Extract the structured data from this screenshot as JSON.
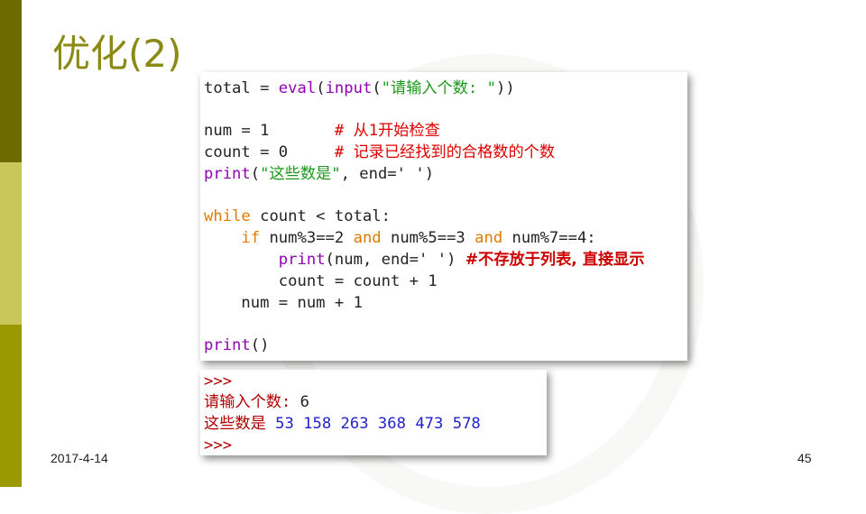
{
  "slide": {
    "title": "优化(2)",
    "date": "2017-4-14",
    "page_number": "45"
  },
  "code": {
    "l1": {
      "a": "total = ",
      "b": "eval",
      "c": "(",
      "d": "input",
      "e": "(",
      "f": "\"请输入个数: \"",
      "g": "))"
    },
    "l3": {
      "a": "num = 1       ",
      "b": "# 从1开始检查"
    },
    "l4": {
      "a": "count = 0     ",
      "b": "# 记录已经找到的合格数的个数"
    },
    "l5": {
      "a": "print",
      "b": "(",
      "c": "\"这些数是\"",
      "d": ", end=' ')"
    },
    "l7": {
      "a": "while",
      "b": " count < total:"
    },
    "l8": {
      "a": "    ",
      "b": "if",
      "c": " num%3==2 ",
      "d": "and",
      "e": " num%5==3 ",
      "f": "and",
      "g": " num%7==4:"
    },
    "l9": {
      "a": "        ",
      "b": "print",
      "c": "(num, end=' ') ",
      "d": "#不存放于列表, 直接显示"
    },
    "l10": {
      "a": "        count = count + 1"
    },
    "l11": {
      "a": "    num = num + 1"
    },
    "l13": {
      "a": "print",
      "b": "()"
    }
  },
  "output": {
    "prompt1": ">>>",
    "input_label": "请输入个数: ",
    "input_value": "6",
    "result_label": "这些数是 ",
    "result_values": "53 158 263 368 473 578",
    "prompt2": ">>>"
  }
}
